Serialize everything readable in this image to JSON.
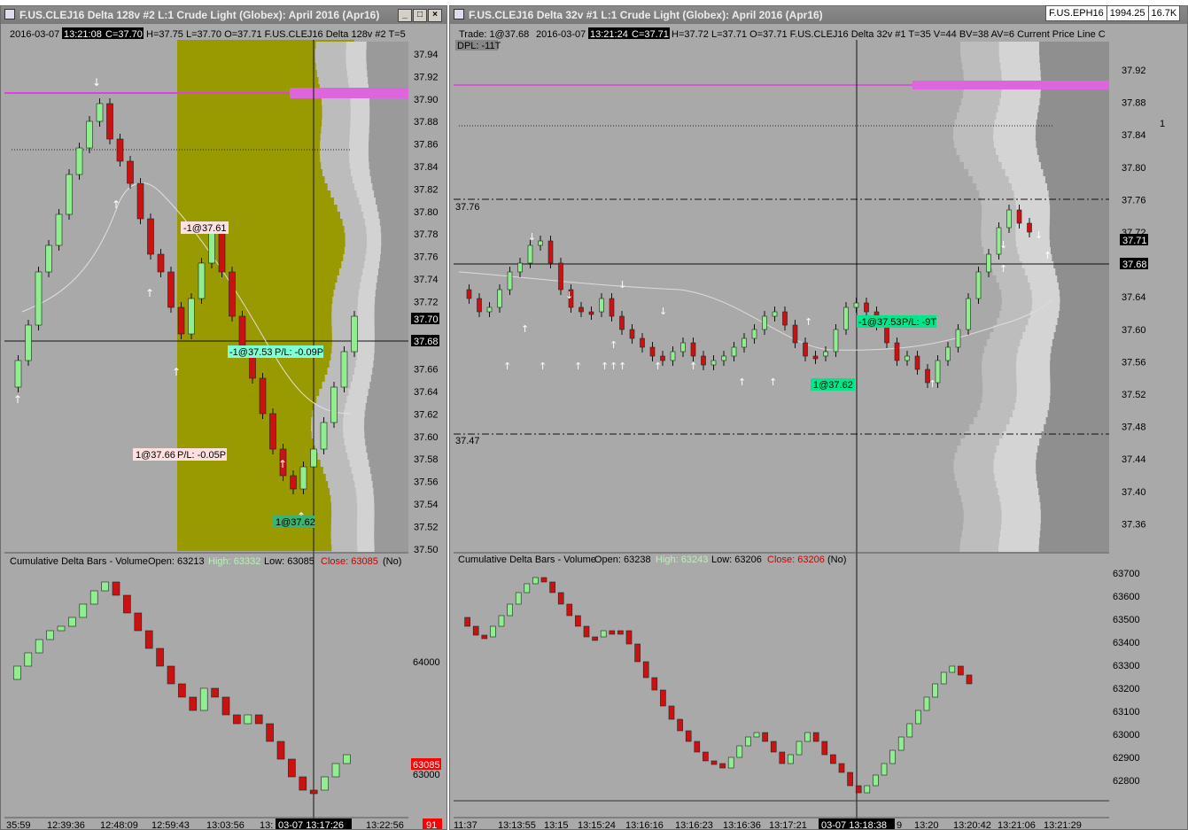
{
  "left": {
    "title": "F.US.CLEJ16  Delta 128v  #2  L:1  Crude Light (Globex): April 2016 (Apr16)",
    "header": {
      "date": "2016-03-07",
      "time": "13:21:08",
      "close": "C=37.70",
      "rest": "H=37.75 L=37.70 O=37.71 F.US.CLEJ16  Delta 128v  #2 T=5"
    },
    "price_labels": [
      "37.94",
      "37.92",
      "37.90",
      "37.88",
      "37.86",
      "37.84",
      "37.82",
      "37.80",
      "37.78",
      "37.76",
      "37.74",
      "37.72",
      "37.70",
      "37.68",
      "37.66",
      "37.64",
      "37.62",
      "37.60",
      "37.58",
      "37.56",
      "37.54",
      "37.52",
      "37.50"
    ],
    "current_price": "37.70",
    "crosshair_price": "37.68",
    "trades": {
      "t1": "-1@37.61",
      "t2": "-1@37.53",
      "t2_pl": "P/L: -0.09P",
      "t3": "1@37.66",
      "t3_pl": "P/L: -0.05P",
      "t4": "1@37.62"
    },
    "study": {
      "name": "Cumulative Delta Bars - Volume",
      "open": "Open: 63213",
      "high": "High: 63332",
      "low": "Low: 63085",
      "close": "Close: 63085",
      "flag": "(No)"
    },
    "study_labels": [
      "64000",
      "63000"
    ],
    "study_close": "63085",
    "time_labels": [
      "35:59",
      "12:39:36",
      "12:48:09",
      "12:59:43",
      "13:03:56",
      "13:"
    ],
    "time_crosshair": "03-07   13:17:26",
    "time_last": "13:22:56",
    "time_badge": "91"
  },
  "right": {
    "title": "F.US.CLEJ16  Delta 32v  #1  L:1  Crude Light (Globex): April 2016 (Apr16)",
    "header": {
      "trade": "Trade:  1@37.68",
      "date": "2016-03-07",
      "time": "13:21:24",
      "close": "C=37.71",
      "rest": "H=37.72 L=37.71 O=37.71 F.US.CLEJ16  Delta 32v  #1 T=35 V=44 BV=38 AV=6  Current Price Line  C"
    },
    "dpl": "DPL: -11T",
    "price_labels": [
      "37.92",
      "37.88",
      "37.84",
      "37.80",
      "37.76",
      "37.72",
      "37.68",
      "37.64",
      "37.60",
      "37.56",
      "37.52",
      "37.48",
      "37.44",
      "37.40",
      "37.36"
    ],
    "current_price": "37.71",
    "crosshair_price": "37.68",
    "level_high": "37.76",
    "level_low": "37.47",
    "trades": {
      "t1": "-1@37.53",
      "t1_pl": "P/L: -9T",
      "t2": "1@37.62"
    },
    "study": {
      "name": "Cumulative Delta Bars - Volume",
      "open": "Open: 63238",
      "high": "High: 63243",
      "low": "Low: 63206",
      "close": "Close: 63206",
      "flag": "(No)"
    },
    "study_labels": [
      "63700",
      "63600",
      "63500",
      "63400",
      "63300",
      "63200",
      "63100",
      "63000",
      "62900",
      "62800"
    ],
    "study_close": "63206",
    "time_labels": [
      "11:37",
      "13:13:55",
      "13:15",
      "13:15:24",
      "13:16:16",
      "13:16:23",
      "13:16:36",
      "13:17:21"
    ],
    "time_crosshair": "03-07   13:18:38",
    "time_labels_b": [
      "9",
      "13:20",
      "13:20:42",
      "13:21:06",
      "13:21:29"
    ]
  },
  "ticker": {
    "symbol": "F.US.EPH16",
    "price": "1994.25",
    "volume": "16.7K"
  },
  "side_number": "1",
  "colors": {
    "zone": "#999900",
    "pink": "#e040e0",
    "up": "#90ee90",
    "down": "#cc1111",
    "bg": "#a9a9a9"
  }
}
